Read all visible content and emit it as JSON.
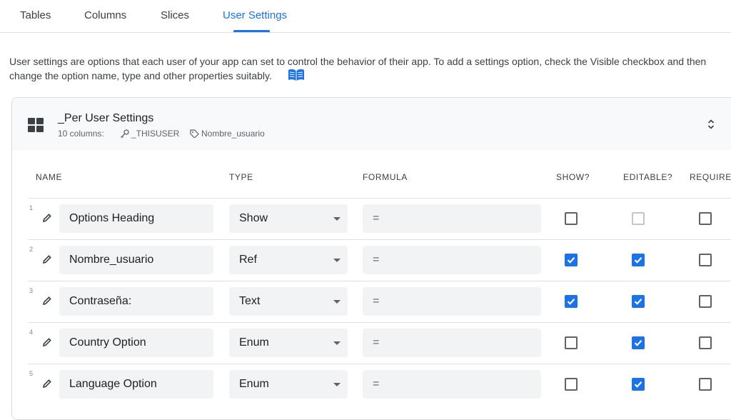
{
  "tabs": [
    {
      "label": "Tables",
      "active": false
    },
    {
      "label": "Columns",
      "active": false
    },
    {
      "label": "Slices",
      "active": false
    },
    {
      "label": "User Settings",
      "active": true
    }
  ],
  "description": {
    "line1": "User settings are options that each user of your app can set to control the behavior of their app. To add a settings option, check the Visible checkbox and then",
    "line2": "change the option name, type and other properties suitably."
  },
  "card": {
    "title": "_Per User Settings",
    "columns_count": "10 columns:",
    "key_label": "_THISUSER",
    "label_label": "Nombre_usuario"
  },
  "headers": {
    "name": "NAME",
    "type": "TYPE",
    "formula": "FORMULA",
    "show": "SHOW?",
    "editable": "EDITABLE?",
    "required": "REQUIRE"
  },
  "rows": [
    {
      "num": "1",
      "name": "Options Heading",
      "type": "Show",
      "formula": "=",
      "show": false,
      "editable": "disabled",
      "required": false
    },
    {
      "num": "2",
      "name": "Nombre_usuario",
      "type": "Ref",
      "formula": "=",
      "show": true,
      "editable": true,
      "required": false
    },
    {
      "num": "3",
      "name": "Contraseña:",
      "type": "Text",
      "formula": "=",
      "show": true,
      "editable": true,
      "required": false
    },
    {
      "num": "4",
      "name": "Country Option",
      "type": "Enum",
      "formula": "=",
      "show": false,
      "editable": true,
      "required": false
    },
    {
      "num": "5",
      "name": "Language Option",
      "type": "Enum",
      "formula": "=",
      "show": false,
      "editable": true,
      "required": false
    }
  ],
  "colors": {
    "accent": "#1a73e8",
    "header_bg": "#f8f9fa",
    "field_bg": "#f1f3f4"
  },
  "icons": {
    "docs": "book-open-icon",
    "table": "grid-icon",
    "key": "key-icon",
    "label": "tag-icon",
    "collapse": "unfold-icon",
    "edit": "pencil-icon"
  }
}
